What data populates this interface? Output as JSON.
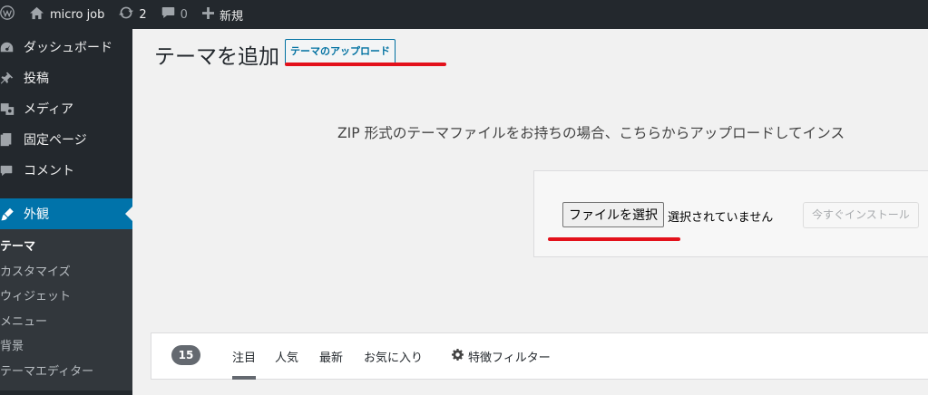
{
  "adminbar": {
    "site_name": "micro job",
    "updates_count": "2",
    "comments_count": "0",
    "new_label": "新規"
  },
  "sidebar": {
    "items": [
      {
        "label": "ダッシュボード",
        "icon": "dashboard-icon"
      },
      {
        "label": "投稿",
        "icon": "pin-icon"
      },
      {
        "label": "メディア",
        "icon": "media-icon"
      },
      {
        "label": "固定ページ",
        "icon": "page-icon"
      },
      {
        "label": "コメント",
        "icon": "comment-icon"
      },
      {
        "label": "外観",
        "icon": "appearance-icon"
      }
    ],
    "submenu": [
      "テーマ",
      "カスタマイズ",
      "ウィジェット",
      "メニュー",
      "背景",
      "テーマエディター"
    ]
  },
  "main": {
    "title": "テーマを追加",
    "upload_button": "テーマのアップロード",
    "intro": "ZIP 形式のテーマファイルをお持ちの場合、こちらからアップロードしてインス",
    "file_button": "ファイルを選択",
    "file_status": "選択されていません",
    "install_button": "今すぐインストール"
  },
  "filter": {
    "count": "15",
    "tabs": [
      "注目",
      "人気",
      "最新",
      "お気に入り"
    ],
    "feature_filter": "特徴フィルター"
  },
  "colors": {
    "adminbar_bg": "#23282d",
    "accent": "#0073aa",
    "highlight": "#e3111b"
  }
}
